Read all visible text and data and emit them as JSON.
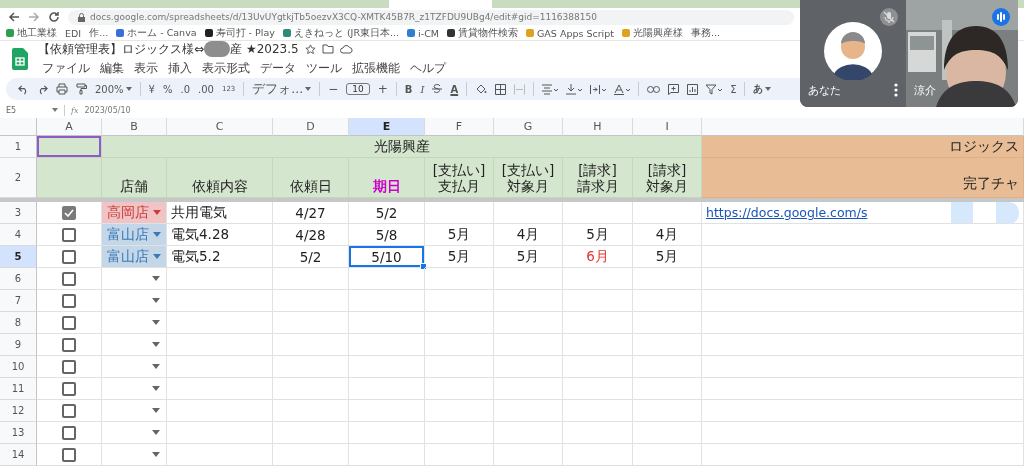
{
  "browser": {
    "url": "docs.google.com/spreadsheets/d/13UvUYgtkjTb5oezvX3CQ-XMTK45B7R_z1TZFDU9UBg4/edit#gid=1116388150",
    "bookmarks": [
      {
        "label": "地工業様",
        "color": "#2e9e4f"
      },
      {
        "label": "EDI"
      },
      {
        "label": "作..."
      },
      {
        "label": "ホーム - Canva",
        "color": "#3b6fd8"
      },
      {
        "label": "寿司打 - Play",
        "color": "#222222"
      },
      {
        "label": "えきねっと (JR東日本...",
        "color": "#2c8c7c"
      },
      {
        "label": "i-CM",
        "color": "#2f7fd0"
      },
      {
        "label": "賃貸物件検索",
        "color": "#333333"
      },
      {
        "label": "GAS Apps Script",
        "color": "#e0a020"
      },
      {
        "label": "光陽興産様",
        "color": "#e0a020"
      },
      {
        "label": "事務..."
      }
    ]
  },
  "document": {
    "title_start": "【依頼管理表】ロジックス様⇔",
    "title_end": "産 ★2023.5",
    "menu": [
      "ファイル",
      "編集",
      "表示",
      "挿入",
      "表示形式",
      "データ",
      "ツール",
      "拡張機能",
      "ヘルプ"
    ]
  },
  "toolbar": {
    "zoom": "200%",
    "currency": "¥",
    "percent": "%",
    "decrease_decimal": ".0",
    "increase_decimal": ".00",
    "number_format": "123",
    "font": "デフォ...",
    "minus": "−",
    "font_size": "10",
    "plus": "+",
    "bold": "B",
    "italic": "I",
    "text_color": "A",
    "sum": "Σ",
    "input_tools": "あ"
  },
  "formula_bar": {
    "cell": "E5",
    "fx": "fx",
    "value": "2023/05/10"
  },
  "sheet": {
    "columns": [
      {
        "label": "A",
        "selected": false
      },
      {
        "label": "B",
        "selected": false
      },
      {
        "label": "C",
        "selected": false
      },
      {
        "label": "D",
        "selected": false
      },
      {
        "label": "E",
        "selected": true
      },
      {
        "label": "F",
        "selected": false
      },
      {
        "label": "G",
        "selected": false
      },
      {
        "label": "H",
        "selected": false
      },
      {
        "label": "I",
        "selected": false
      }
    ],
    "header_rows": [
      {
        "num": "1",
        "selected": false,
        "collaborator_cursor": true
      },
      {
        "num": "2",
        "selected": false,
        "collaborator_cursor": false
      }
    ],
    "group": "光陽興産",
    "group_right": "ロジックス",
    "labels": [
      {
        "text": "店舗",
        "emphasis": false
      },
      {
        "text": "依頼内容",
        "emphasis": false
      },
      {
        "text": "依頼日",
        "emphasis": false
      },
      {
        "text": "期日",
        "emphasis": true
      },
      {
        "text": "[支払い]\n支払月",
        "emphasis": false
      },
      {
        "text": "[支払い]\n対象月",
        "emphasis": false
      },
      {
        "text": "[請求]\n請求月",
        "emphasis": false
      },
      {
        "text": "[請求]\n対象月",
        "emphasis": false
      }
    ],
    "right_label": "完了チャ",
    "rows": [
      {
        "num": "3",
        "selected": false,
        "checked": true,
        "store": {
          "text": "高岡店",
          "color": "#cc3b3b"
        },
        "content": "共用電気",
        "requested": "4/27",
        "due": "5/2",
        "due_selected": false,
        "link": "https://docs.google.com/s"
      },
      {
        "num": "4",
        "selected": false,
        "checked": false,
        "store": {
          "text": "富山店",
          "color": "#3b78b5"
        },
        "content": "電気4.28",
        "requested": "4/28",
        "due": "5/8",
        "due_selected": false,
        "pay_month": "5月",
        "pay_target": "4月",
        "bill_month": "5月",
        "bill_month_alert": false,
        "bill_target": "4月"
      },
      {
        "num": "5",
        "selected": true,
        "checked": false,
        "store": {
          "text": "富山店",
          "color": "#3b78b5"
        },
        "content": "電気5.2",
        "requested": "5/2",
        "due": "5/10",
        "due_selected": true,
        "pay_month": "5月",
        "pay_target": "5月",
        "bill_month": "6月",
        "bill_month_alert": true,
        "bill_target": "5月"
      },
      {
        "num": "6",
        "selected": false,
        "checked": false
      },
      {
        "num": "7",
        "selected": false,
        "checked": false
      },
      {
        "num": "8",
        "selected": false,
        "checked": false
      },
      {
        "num": "9",
        "selected": false,
        "checked": false
      },
      {
        "num": "10",
        "selected": false,
        "checked": false
      },
      {
        "num": "11",
        "selected": false,
        "checked": false
      },
      {
        "num": "12",
        "selected": false,
        "checked": false
      },
      {
        "num": "13",
        "selected": false,
        "checked": false
      },
      {
        "num": "14",
        "selected": false,
        "checked": false
      }
    ]
  },
  "call": {
    "tiles": [
      {
        "name": "あなた",
        "kind": "avatar",
        "muted": true,
        "speaking": false
      },
      {
        "name": "涼介",
        "kind": "camera",
        "muted": false,
        "speaking": true
      }
    ]
  }
}
